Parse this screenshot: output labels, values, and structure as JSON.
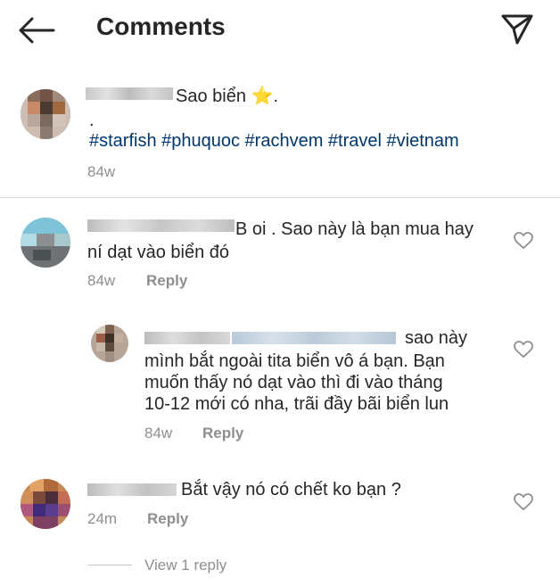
{
  "header": {
    "title": "Comments"
  },
  "caption": {
    "text": "Sao biển",
    "star": "⭐",
    "trail": ".",
    "dot_line": ".",
    "hashtags": "#starfish #phuquoc #rachvem #travel #vietnam",
    "time": "84w"
  },
  "comments": [
    {
      "line1": "B oi . Sao này là bạn mua hay",
      "line2": "ní dạt vào biển đó",
      "time": "84w",
      "reply_label": "Reply"
    },
    {
      "line1": "sao này",
      "line2": "mình bắt ngoài tita biển vô á bạn. Bạn",
      "line3": "muốn thấy nó dạt vào thì đi vào tháng",
      "line4": "10-12 mới có nha, trãi đầy bãi biển lun",
      "time": "84w",
      "reply_label": "Reply"
    },
    {
      "line1": "Bắt vậy nó có chết ko bạn ?",
      "time": "24m",
      "reply_label": "Reply",
      "view_replies": "View 1 reply"
    }
  ],
  "icons": {
    "back": "arrow-left-icon",
    "send": "paper-plane-icon",
    "like": "heart-icon"
  }
}
